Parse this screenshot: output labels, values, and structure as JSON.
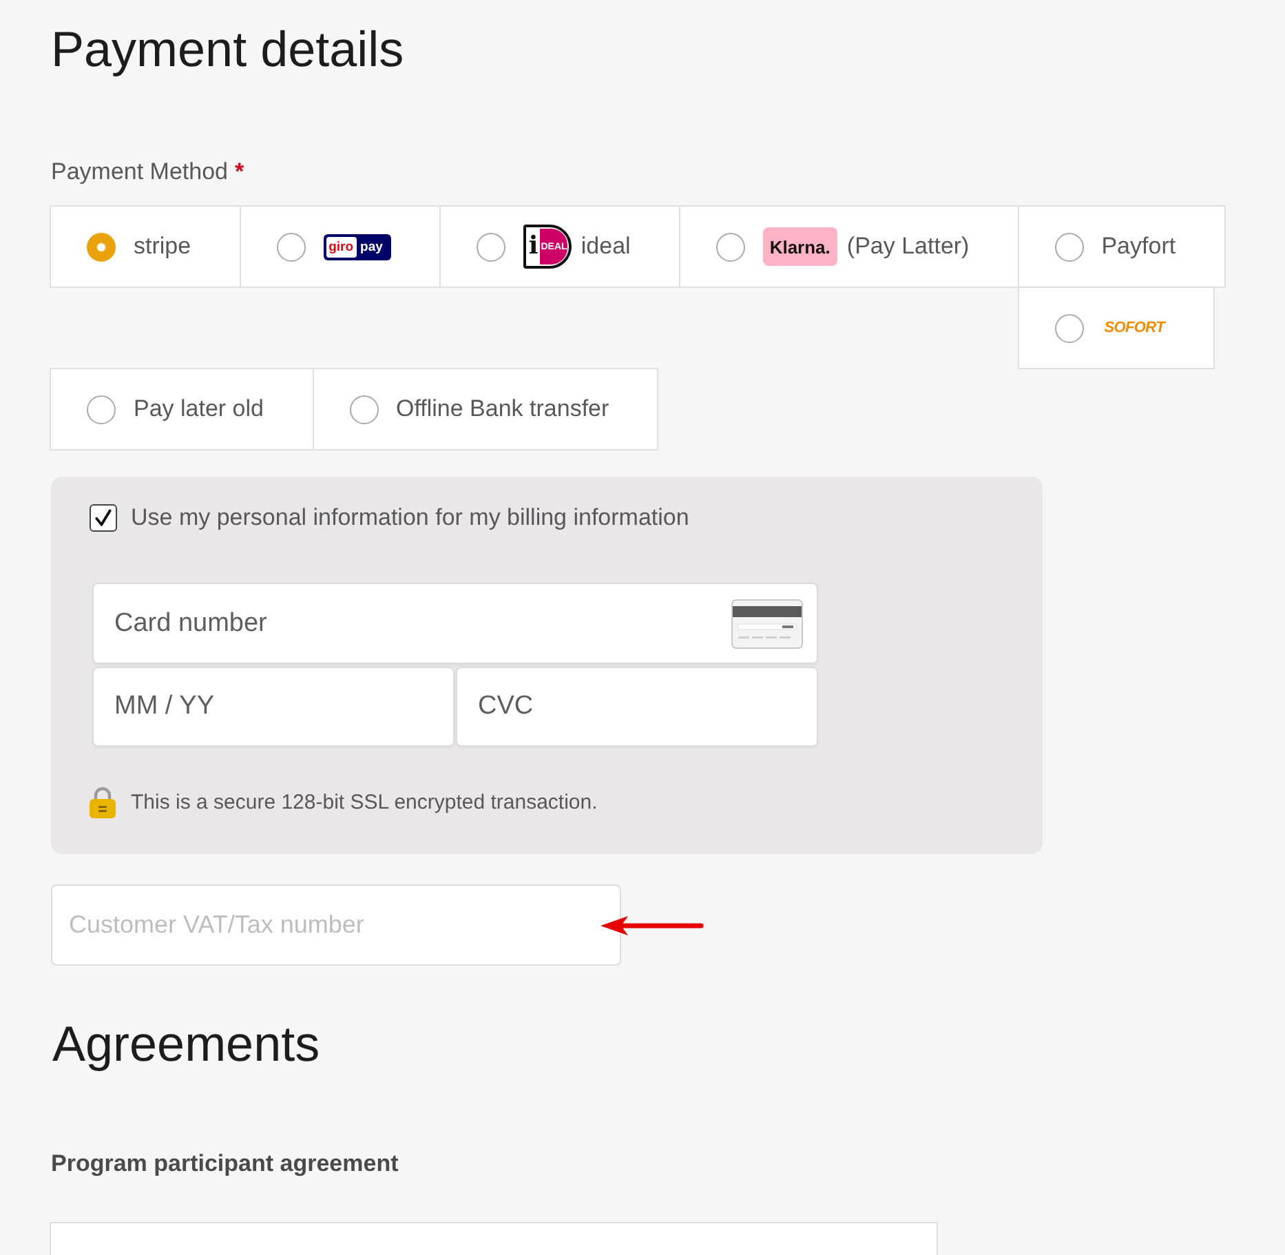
{
  "page_title": "Payment details",
  "payment_method": {
    "label": "Payment Method",
    "required_mark": "*",
    "options": [
      {
        "label": "stripe",
        "selected": true
      },
      {
        "logo": {
          "kind": "giropay",
          "text": [
            "giro",
            "pay"
          ]
        },
        "selected": false
      },
      {
        "logo": {
          "kind": "ideal",
          "text": [
            "i",
            "DEAL"
          ]
        },
        "label": "ideal",
        "selected": false
      },
      {
        "logo": {
          "kind": "klarna",
          "text": [
            "Klarna."
          ]
        },
        "label": "(Pay Latter)",
        "selected": false
      },
      {
        "label": "Payfort",
        "selected": false
      },
      {
        "logo": {
          "kind": "sofort",
          "text": [
            "SOFORT"
          ]
        },
        "selected": false
      },
      {
        "label": "Pay later old",
        "selected": false
      },
      {
        "label": "Offline Bank transfer",
        "selected": false
      }
    ]
  },
  "billing": {
    "use_personal_info": {
      "label": "Use my personal information for my billing information",
      "checked": true
    },
    "card": {
      "number_placeholder": "Card number",
      "expiry_placeholder": "MM / YY",
      "cvc_placeholder": "CVC"
    },
    "secure_note": "This is a secure 128-bit SSL encrypted transaction."
  },
  "vat": {
    "placeholder": "Customer VAT/Tax number"
  },
  "agreements": {
    "title": "Agreements",
    "items": [
      {
        "title": "Program participant agreement"
      }
    ]
  }
}
